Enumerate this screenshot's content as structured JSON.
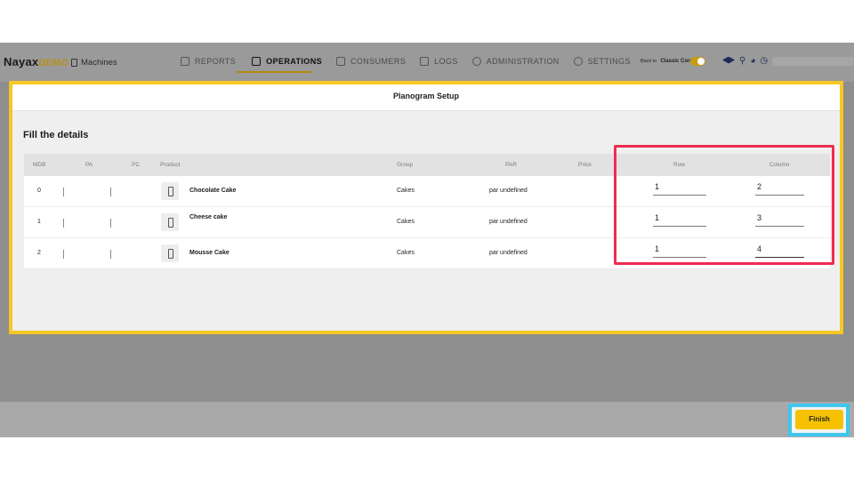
{
  "header": {
    "logo": "Nayax",
    "logo_suffix": "DEMO",
    "breadcrumb": "Machines",
    "nav": [
      "REPORTS",
      "OPERATIONS",
      "CONSUMERS",
      "LOGS",
      "ADMINISTRATION",
      "SETTINGS"
    ],
    "active_nav": "OPERATIONS",
    "classic_prefix": "Back to",
    "classic_label": "Classic Core",
    "classic_toggle_on": true
  },
  "modal": {
    "title": "Planogram Setup",
    "section_title": "Fill the details",
    "columns": [
      "MDB",
      "PA",
      "PC",
      "Product",
      "Group",
      "PAR",
      "Price",
      "Row",
      "Column"
    ],
    "rows": [
      {
        "mdb": "0",
        "product": "Chocolate Cake",
        "group": "Cakes",
        "par": "par undefined",
        "row": "1",
        "column": "2"
      },
      {
        "mdb": "1",
        "product": "Cheese cake",
        "group": "Cakes",
        "par": "par undefined",
        "row": "1",
        "column": "3"
      },
      {
        "mdb": "2",
        "product": "Mousse Cake",
        "group": "Cakes",
        "par": "par undefined",
        "row": "1",
        "column": "4"
      }
    ]
  },
  "footer": {
    "finish_label": "Finish"
  },
  "colors": {
    "accent_yellow": "#f7c724",
    "highlight_red": "#ef2c4f",
    "highlight_blue": "#3ec6ef",
    "finish_button": "#f6c200"
  }
}
